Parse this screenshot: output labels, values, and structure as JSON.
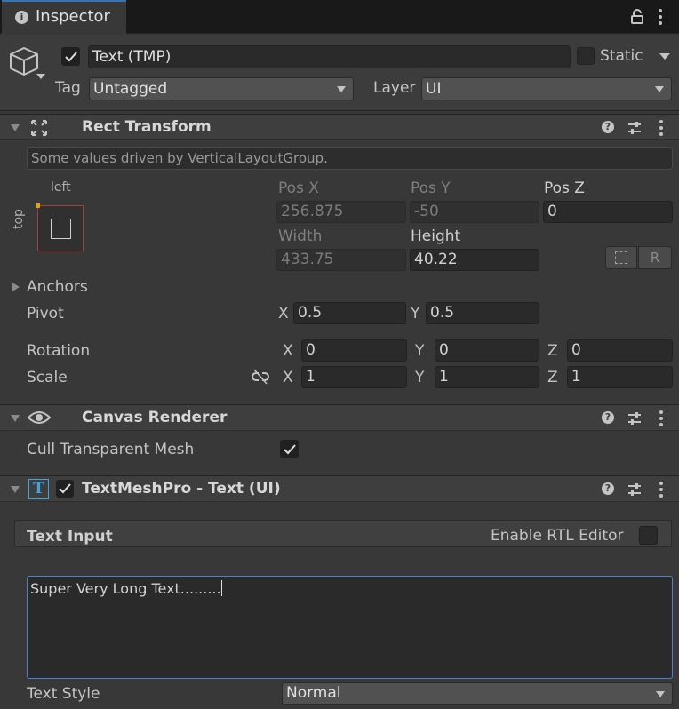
{
  "tab": {
    "title": "Inspector"
  },
  "object": {
    "name": "Text (TMP)",
    "static_label": "Static",
    "tag_label": "Tag",
    "tag_value": "Untagged",
    "layer_label": "Layer",
    "layer_value": "UI"
  },
  "rect_transform": {
    "title": "Rect Transform",
    "driven_note": "Some values driven by VerticalLayoutGroup.",
    "anchor_h": "left",
    "anchor_v": "top",
    "pos_x_label": "Pos X",
    "pos_y_label": "Pos Y",
    "pos_z_label": "Pos Z",
    "pos_x": "256.875",
    "pos_y": "-50",
    "pos_z": "0",
    "width_label": "Width",
    "height_label": "Height",
    "width": "433.75",
    "height": "40.22",
    "r_button": "R",
    "anchors_label": "Anchors",
    "pivot_label": "Pivot",
    "pivot_x": "0.5",
    "pivot_y": "0.5",
    "rotation_label": "Rotation",
    "rot_x": "0",
    "rot_y": "0",
    "rot_z": "0",
    "scale_label": "Scale",
    "scale_x": "1",
    "scale_y": "1",
    "scale_z": "1",
    "x": "X",
    "y": "Y",
    "z": "Z"
  },
  "canvas_renderer": {
    "title": "Canvas Renderer",
    "cull_label": "Cull Transparent Mesh",
    "cull_checked": true
  },
  "tmp": {
    "title": "TextMeshPro - Text (UI)",
    "icon_letter": "T",
    "text_input_label": "Text Input",
    "rtl_label": "Enable RTL Editor",
    "text_value": "Super Very Long Text.........",
    "text_style_label": "Text Style",
    "text_style_value": "Normal"
  },
  "header_buttons": {
    "help": "?",
    "more": "⋮"
  },
  "colors": {
    "accent": "#4c7fd8",
    "background": "#383838"
  }
}
